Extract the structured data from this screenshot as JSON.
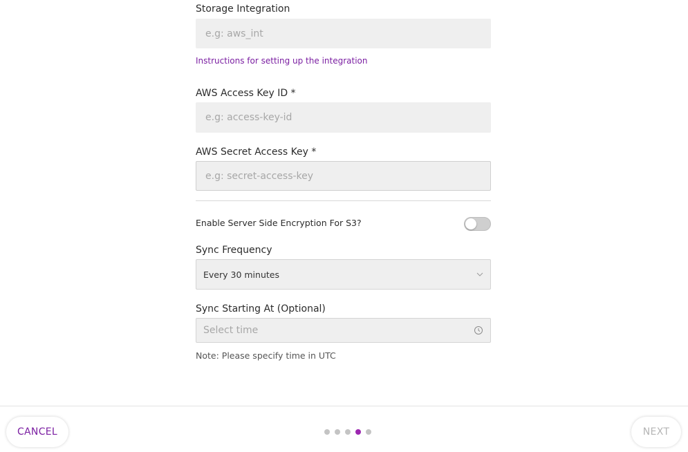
{
  "form": {
    "storage_integration": {
      "label": "Storage Integration",
      "placeholder": "e.g: aws_int",
      "value": ""
    },
    "instructions_link": "Instructions for setting up the integration",
    "aws_access_key_id": {
      "label": "AWS Access Key ID *",
      "placeholder": "e.g: access-key-id",
      "value": ""
    },
    "aws_secret_access_key": {
      "label": "AWS Secret Access Key *",
      "placeholder": "e.g: secret-access-key",
      "value": ""
    },
    "sse": {
      "label": "Enable Server Side Encryption For S3?",
      "enabled": false
    },
    "sync_frequency": {
      "label": "Sync Frequency",
      "selected": "Every 30 minutes"
    },
    "sync_starting_at": {
      "label": "Sync Starting At (Optional)",
      "placeholder": "Select time"
    },
    "note": "Note: Please specify time in UTC"
  },
  "footer": {
    "cancel_label": "CANCEL",
    "next_label": "NEXT",
    "steps_total": 5,
    "current_step": 4
  },
  "colors": {
    "accent": "#7b1fa2",
    "active_dot": "#9c27b0",
    "input_bg": "#efefef"
  }
}
